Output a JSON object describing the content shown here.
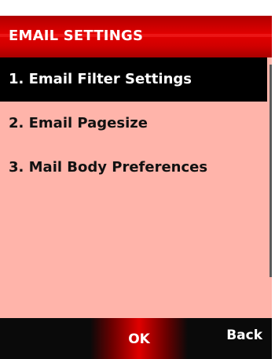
{
  "header": {
    "title": "EMAIL SETTINGS"
  },
  "menu": {
    "items": [
      {
        "label": "1. Email Filter Settings",
        "selected": true
      },
      {
        "label": "2. Email Pagesize",
        "selected": false
      },
      {
        "label": "3. Mail Body Preferences",
        "selected": false
      }
    ]
  },
  "softkeys": {
    "center_label": "OK",
    "right_label": "Back"
  },
  "colors": {
    "header_red": "#d40000",
    "content_bg": "#ffb4aa",
    "selected_bg": "#000000",
    "softkey_bg": "#0a0a0a"
  }
}
